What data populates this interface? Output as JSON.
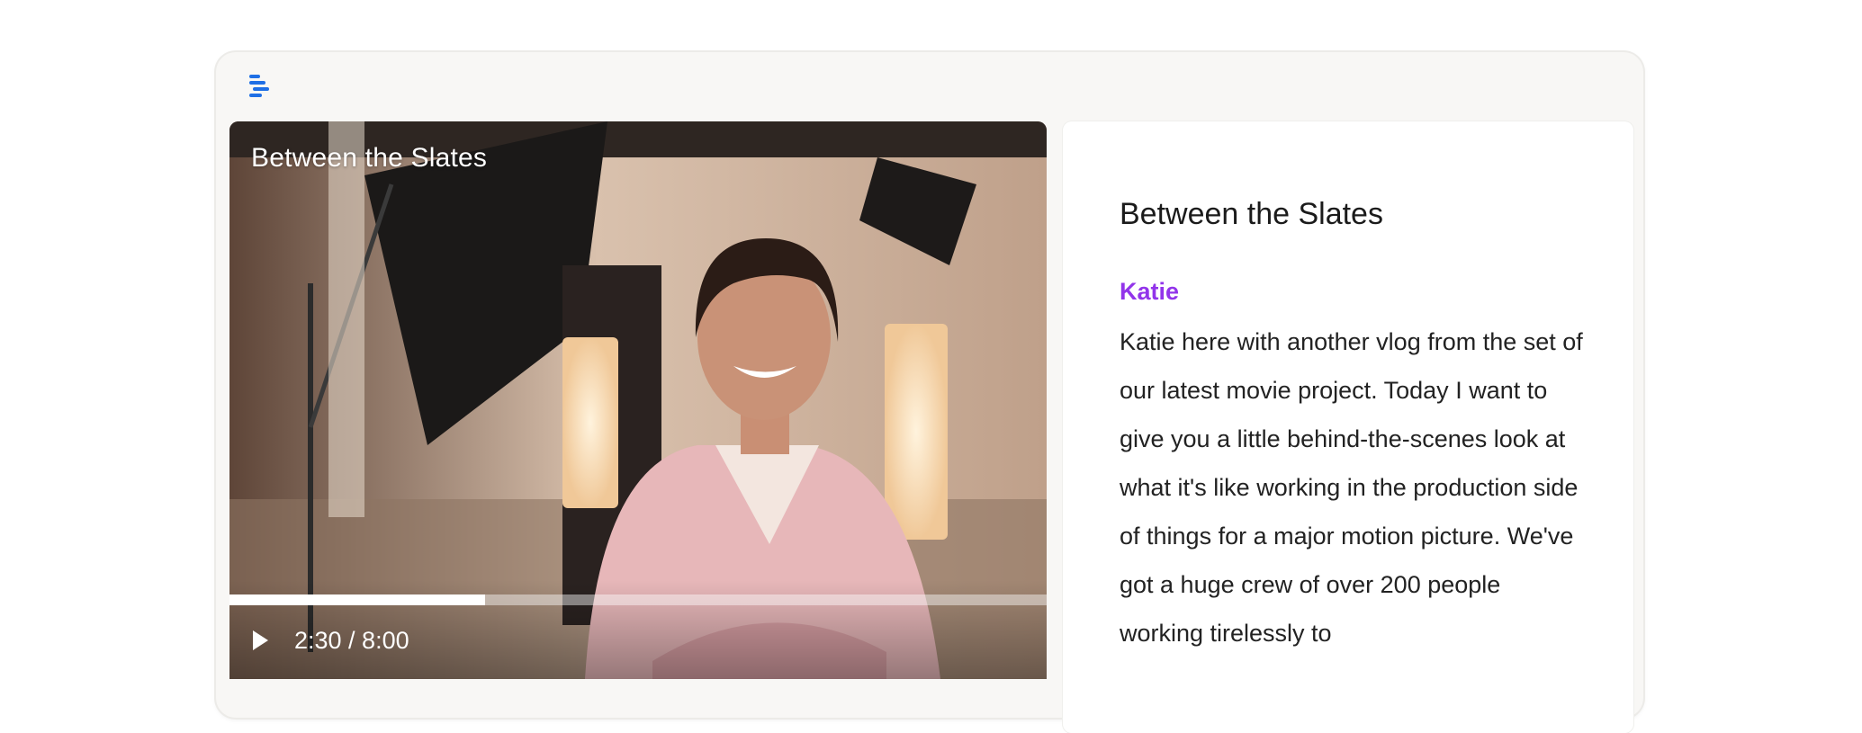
{
  "app": {
    "logo_icon": "stacked-bars-logo-icon",
    "accent_color": "#1f6fe5"
  },
  "video": {
    "title": "Between the Slates",
    "time_display": "2:30 / 8:00",
    "progress_fraction": 0.3125,
    "play_icon": "play-icon"
  },
  "panel": {
    "title": "Between the Slates",
    "author": "Katie",
    "author_color": "#9234ea",
    "body": "Katie here with another vlog from the set of our latest movie project. Today I want to give you a little behind-the-scenes look at what it's like working in the production side of things for a major motion picture. We've got a huge crew of over 200 people working tirelessly to"
  }
}
